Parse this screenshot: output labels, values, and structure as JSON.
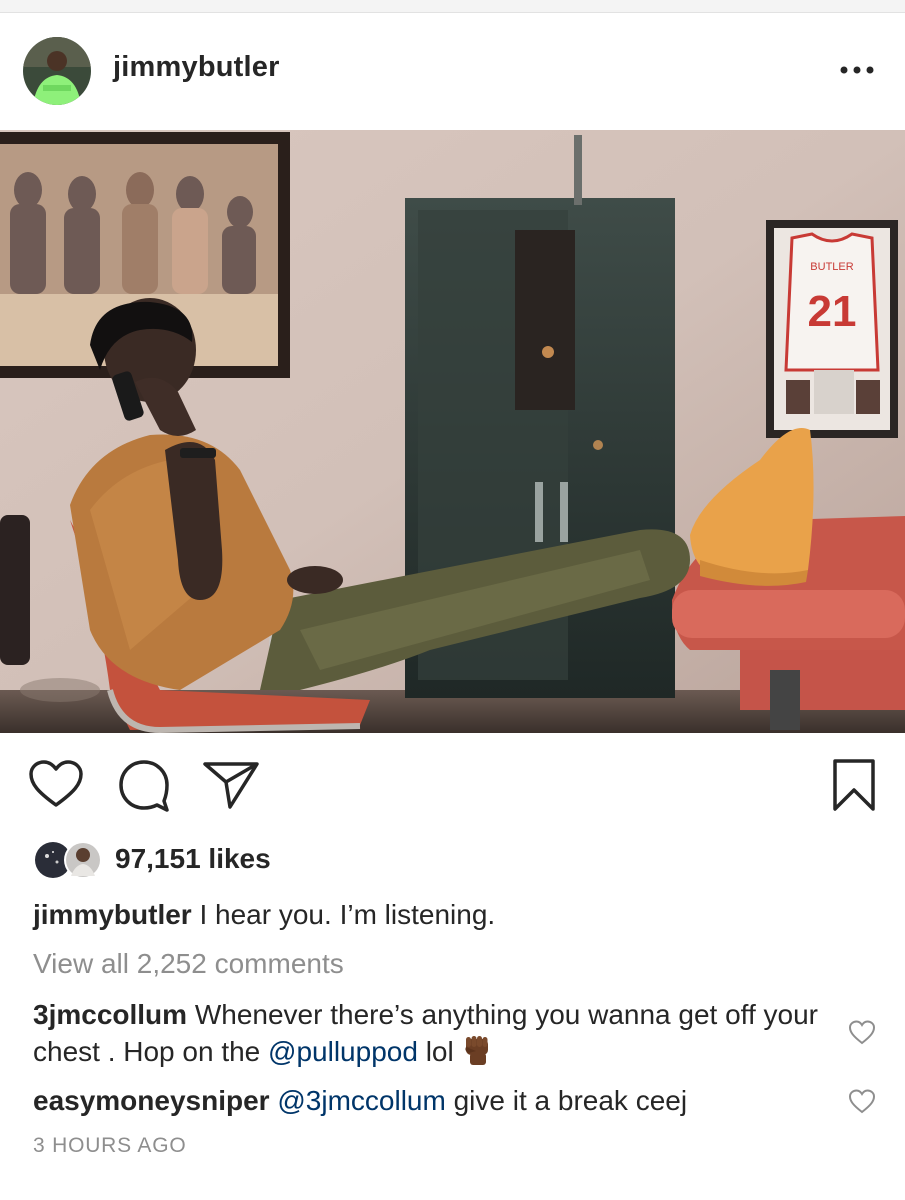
{
  "post": {
    "username": "jimmybutler",
    "more_icon": "more-horizontal-icon",
    "photo_alt": "Man on phone leaning back in chair with feet on table",
    "jersey_number": "21",
    "jersey_name": "BUTLER",
    "actions": {
      "like_icon": "heart-outline-icon",
      "comment_icon": "comment-bubble-icon",
      "share_icon": "paper-plane-icon",
      "save_icon": "bookmark-outline-icon"
    },
    "likes_text": "97,151 likes",
    "caption": {
      "username": "jimmybutler",
      "text": " I hear you. I’m listening."
    },
    "view_all_comments": "View all 2,252 comments",
    "comments": [
      {
        "username": "3jmccollum",
        "text_before": " Whenever there’s anything you wanna get off your chest . Hop on the ",
        "mention": "@pulluppod",
        "text_after": " lol",
        "emoji": "raised-fist-emoji"
      },
      {
        "username": "easymoneysniper",
        "text_before": " ",
        "mention": "@3jmccollum",
        "text_after": " give it a break ceej"
      }
    ],
    "timestamp": "3 HOURS AGO"
  },
  "colors": {
    "text": "#262626",
    "secondary": "#8e8e8e",
    "mention": "#003569"
  }
}
